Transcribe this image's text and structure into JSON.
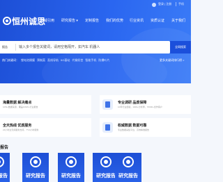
{
  "topbar": {
    "login": "登录 | 注册",
    "mobile": "手机"
  },
  "logo": {
    "text": "恒州诚思"
  },
  "nav": {
    "items": [
      "权威引用",
      "研究报告 ▾",
      "定制报告",
      "我们的优势",
      "行业资讯",
      "资质认证",
      "关于我们"
    ]
  },
  "search": {
    "scope": "报告",
    "placeholder": "输入多个报告关键词，请用空格隔开，如汽车 机器人",
    "button": "全网搜索"
  },
  "hot": {
    "label": "热门关键词：",
    "keywords": [
      "锂电池隔膜",
      "预制菜",
      "直线导轨",
      "5G基站",
      "代餐奶昔",
      "智能手机",
      "防爆叶片"
    ],
    "more": "更多关键词排行榜 >"
  },
  "features": [
    {
      "title": "海量数据 解决痛点",
      "sub": "10W+数据来源，覆盖100W+行业报告"
    },
    {
      "title": "专业调研 品质保障",
      "sub": "10年行业经验，1000+分析师，70000+合作客户"
    },
    {
      "title": "全天热线 优质服务",
      "sub": "24小时全天候服务支持，7*24小时服务"
    },
    {
      "title": "权威数据 数据可靠",
      "sub": "专业数据采集平台，高效精准报告"
    }
  ],
  "reports_section": {
    "title": "报告"
  },
  "reports": [
    {
      "label": "研究报告"
    },
    {
      "label": "研究报告"
    },
    {
      "label": "研究报告"
    },
    {
      "label": "研究报告"
    },
    {
      "label": "研究报告"
    }
  ]
}
